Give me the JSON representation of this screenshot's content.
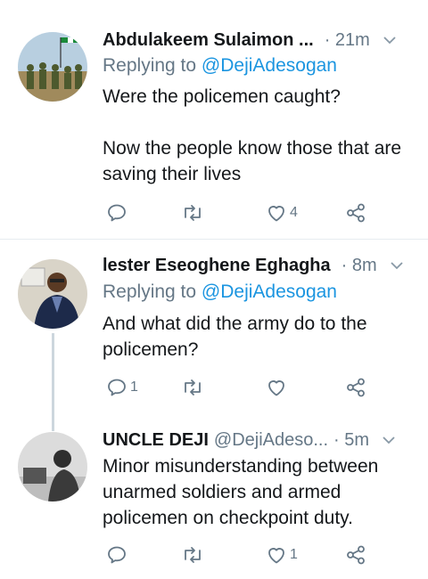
{
  "tweets": [
    {
      "name": "Abdulakeem Sulaimon ...",
      "handle": "",
      "time": "· 21m",
      "replying_prefix": "Replying to",
      "replying_to": "@DejiAdesogan",
      "body_lines": [
        "Were the policemen caught?",
        "Now the people know those that are saving their lives"
      ],
      "reply_count": "",
      "retweet_count": "",
      "like_count": "4"
    },
    {
      "name": "lester Eseoghene Eghagha",
      "handle": "",
      "time": "· 8m",
      "replying_prefix": "Replying to",
      "replying_to": "@DejiAdesogan",
      "body_lines": [
        "And what did the army do to the policemen?"
      ],
      "reply_count": "1",
      "retweet_count": "",
      "like_count": ""
    },
    {
      "name": "UNCLE DEJI",
      "handle": "@DejiAdeso...",
      "time": "· 5m",
      "replying_prefix": "",
      "replying_to": "",
      "body_lines": [
        "Minor misunderstanding between unarmed soldiers and armed policemen on checkpoint duty."
      ],
      "reply_count": "",
      "retweet_count": "",
      "like_count": "1"
    }
  ],
  "icons": {
    "reply": "reply-icon",
    "retweet": "retweet-icon",
    "like": "heart-icon",
    "share": "share-icon",
    "caret": "chevron-down-icon"
  },
  "colors": {
    "link": "#1b95e0",
    "secondary": "#657786",
    "divider": "#e6ecf0",
    "thread_line": "#ccd6dd"
  }
}
